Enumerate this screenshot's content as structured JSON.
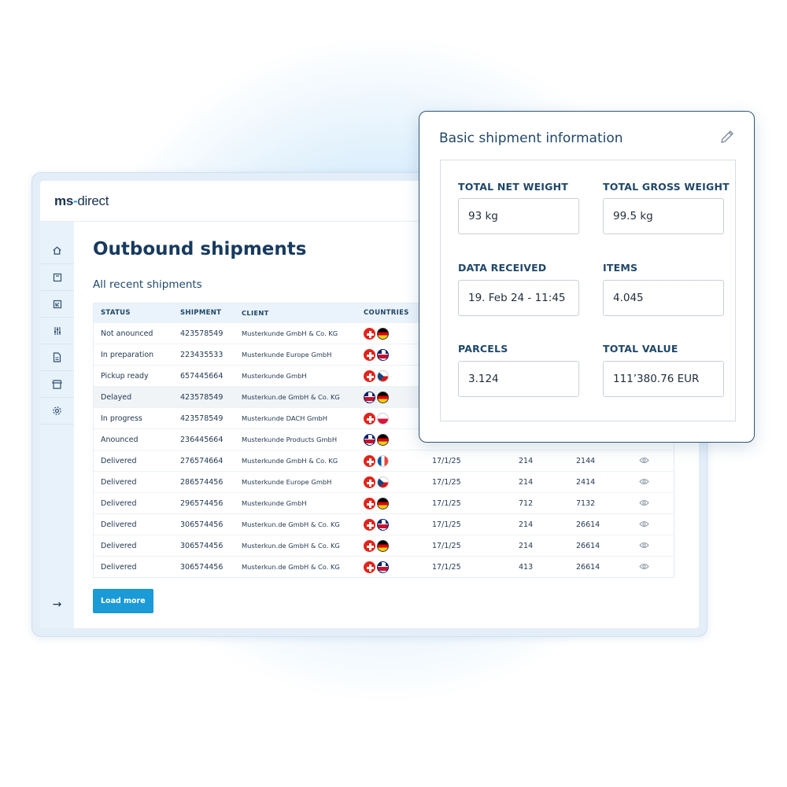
{
  "logo": {
    "ms": "ms",
    "sep": "-",
    "direct": "direct"
  },
  "sidebar": {
    "icons": [
      "home-icon",
      "box-icon",
      "return-icon",
      "sliders-icon",
      "document-icon",
      "store-icon",
      "gear-icon"
    ],
    "collapse_icon": "arrow-right-icon"
  },
  "main": {
    "title": "Outbound shipments",
    "subtitle": "All recent shipments",
    "load_more": "Load more"
  },
  "table": {
    "headers": [
      "STATUS",
      "SHIPMENT",
      "CLIENT",
      "COUNTRIES"
    ],
    "rows": [
      {
        "status": "Not anounced",
        "shipment": "423578549",
        "client": "Musterkunde GmbH & Co. KG",
        "flags": [
          "ch",
          "de"
        ],
        "date": "",
        "parcels": "",
        "items": ""
      },
      {
        "status": "In preparation",
        "shipment": "223435533",
        "client": "Musterkunde Europe GmbH",
        "flags": [
          "ch",
          "gb"
        ],
        "date": "",
        "parcels": "",
        "items": ""
      },
      {
        "status": "Pickup ready",
        "shipment": "657445664",
        "client": "Musterkunde GmbH",
        "flags": [
          "ch",
          "cz"
        ],
        "date": "",
        "parcels": "",
        "items": ""
      },
      {
        "status": "Delayed",
        "shipment": "423578549",
        "client": "Musterkun.de GmbH & Co. KG",
        "flags": [
          "gb",
          "de"
        ],
        "date": "",
        "parcels": "",
        "items": ""
      },
      {
        "status": "In progress",
        "shipment": "423578549",
        "client": "Musterkunde DACH GmbH",
        "flags": [
          "ch",
          "pl"
        ],
        "date": "",
        "parcels": "",
        "items": ""
      },
      {
        "status": "Anounced",
        "shipment": "236445664",
        "client": "Musterkunde Products GmbH",
        "flags": [
          "gb",
          "de"
        ],
        "date": "",
        "parcels": "",
        "items": ""
      },
      {
        "status": "Delivered",
        "shipment": "276574664",
        "client": "Musterkunde GmbH & Co. KG",
        "flags": [
          "ch",
          "fr"
        ],
        "date": "17/1/25",
        "parcels": "214",
        "items": "2144"
      },
      {
        "status": "Delivered",
        "shipment": "286574456",
        "client": "Musterkunde Europe GmbH",
        "flags": [
          "ch",
          "cz"
        ],
        "date": "17/1/25",
        "parcels": "214",
        "items": "2414"
      },
      {
        "status": "Delivered",
        "shipment": "296574456",
        "client": "Musterkunde GmbH",
        "flags": [
          "ch",
          "de"
        ],
        "date": "17/1/25",
        "parcels": "712",
        "items": "7132"
      },
      {
        "status": "Delivered",
        "shipment": "306574456",
        "client": "Musterkun.de GmbH & Co. KG",
        "flags": [
          "ch",
          "gb"
        ],
        "date": "17/1/25",
        "parcels": "214",
        "items": "26614"
      },
      {
        "status": "Delivered",
        "shipment": "306574456",
        "client": "Musterkun.de GmbH & Co. KG",
        "flags": [
          "ch",
          "de"
        ],
        "date": "17/1/25",
        "parcels": "214",
        "items": "26614"
      },
      {
        "status": "Delivered",
        "shipment": "306574456",
        "client": "Musterkun.de GmbH & Co. KG",
        "flags": [
          "ch",
          "gb"
        ],
        "date": "17/1/25",
        "parcels": "413",
        "items": "26614"
      }
    ]
  },
  "card": {
    "title": "Basic shipment information",
    "edit_icon": "pencil-icon",
    "fields": {
      "net_weight_label": "TOTAL NET WEIGHT",
      "net_weight": "93 kg",
      "gross_weight_label": "TOTAL GROSS WEIGHT",
      "gross_weight": "99.5 kg",
      "received_label": "DATA RECEIVED",
      "received": "19. Feb 24 - 11:45",
      "items_label": "ITEMS",
      "items": "4.045",
      "parcels_label": "PARCELS",
      "parcels": "3.124",
      "value_label": "TOTAL VALUE",
      "value": "111’380.76 EUR"
    }
  }
}
